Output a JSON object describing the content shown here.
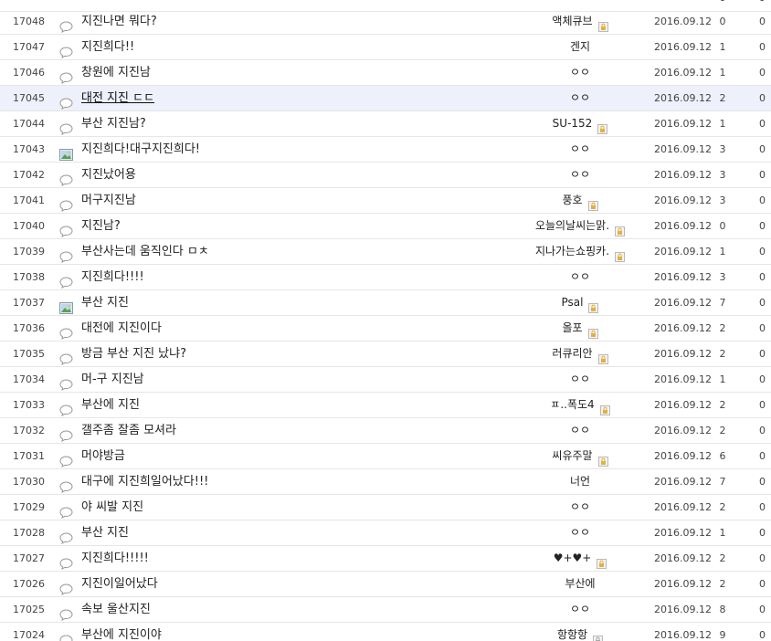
{
  "top_row": {
    "views": "0",
    "likes": "0"
  },
  "rows": [
    {
      "num": "17048",
      "icon": "speech-bubble-icon",
      "subject": "지진나면 뭐다?",
      "writer": "액체큐브",
      "badge": "gold-lock",
      "date": "2016.09.12",
      "views": "0",
      "likes": "0",
      "highlight": false
    },
    {
      "num": "17047",
      "icon": "speech-bubble-icon",
      "subject": "지진희다!!",
      "writer": "겐지",
      "badge": "",
      "date": "2016.09.12",
      "views": "1",
      "likes": "0",
      "highlight": false
    },
    {
      "num": "17046",
      "icon": "speech-bubble-icon",
      "subject": "창원에 지진남",
      "writer": "ㅇㅇ",
      "badge": "",
      "date": "2016.09.12",
      "views": "1",
      "likes": "0",
      "highlight": false
    },
    {
      "num": "17045",
      "icon": "speech-bubble-icon",
      "subject": "대전 지진 ㄷㄷ",
      "writer": "ㅇㅇ",
      "badge": "",
      "date": "2016.09.12",
      "views": "2",
      "likes": "0",
      "highlight": true
    },
    {
      "num": "17044",
      "icon": "speech-bubble-icon",
      "subject": "부산 지진남?",
      "writer": "SU-152",
      "badge": "gold-lock",
      "date": "2016.09.12",
      "views": "1",
      "likes": "0",
      "highlight": false
    },
    {
      "num": "17043",
      "icon": "image-icon",
      "subject": "지진희다!대구지진희다!",
      "writer": "ㅇㅇ",
      "badge": "",
      "date": "2016.09.12",
      "views": "3",
      "likes": "0",
      "highlight": false
    },
    {
      "num": "17042",
      "icon": "speech-bubble-icon",
      "subject": "지진났어용",
      "writer": "ㅇㅇ",
      "badge": "",
      "date": "2016.09.12",
      "views": "3",
      "likes": "0",
      "highlight": false
    },
    {
      "num": "17041",
      "icon": "speech-bubble-icon",
      "subject": "머구지진남",
      "writer": "풍호",
      "badge": "gold-lock",
      "date": "2016.09.12",
      "views": "3",
      "likes": "0",
      "highlight": false
    },
    {
      "num": "17040",
      "icon": "speech-bubble-icon",
      "subject": "지진남?",
      "writer": "오늘의날씨는맑.",
      "badge": "gold-lock",
      "date": "2016.09.12",
      "views": "0",
      "likes": "0",
      "highlight": false
    },
    {
      "num": "17039",
      "icon": "speech-bubble-icon",
      "subject": "부산사는데 움직인다 ㅁㅊ",
      "writer": "지나가는쇼핑카.",
      "badge": "gold-lock",
      "date": "2016.09.12",
      "views": "1",
      "likes": "0",
      "highlight": false
    },
    {
      "num": "17038",
      "icon": "speech-bubble-icon",
      "subject": "지진희다!!!!",
      "writer": "ㅇㅇ",
      "badge": "",
      "date": "2016.09.12",
      "views": "3",
      "likes": "0",
      "highlight": false
    },
    {
      "num": "17037",
      "icon": "image-icon",
      "subject": "부산 지진",
      "writer": "Psal",
      "badge": "gold-lock",
      "date": "2016.09.12",
      "views": "7",
      "likes": "0",
      "highlight": false
    },
    {
      "num": "17036",
      "icon": "speech-bubble-icon",
      "subject": "대전에 지진이다",
      "writer": "올포",
      "badge": "gold-lock",
      "date": "2016.09.12",
      "views": "2",
      "likes": "0",
      "highlight": false
    },
    {
      "num": "17035",
      "icon": "speech-bubble-icon",
      "subject": "방금 부산 지진 났냐?",
      "writer": "러큐리안",
      "badge": "gold-lock",
      "date": "2016.09.12",
      "views": "2",
      "likes": "0",
      "highlight": false
    },
    {
      "num": "17034",
      "icon": "speech-bubble-icon",
      "subject": "머-구 지진남",
      "writer": "ㅇㅇ",
      "badge": "",
      "date": "2016.09.12",
      "views": "1",
      "likes": "0",
      "highlight": false
    },
    {
      "num": "17033",
      "icon": "speech-bubble-icon",
      "subject": "부산에 지진",
      "writer": "ㅍ..폭도4",
      "badge": "gold-lock",
      "date": "2016.09.12",
      "views": "2",
      "likes": "0",
      "highlight": false
    },
    {
      "num": "17032",
      "icon": "speech-bubble-icon",
      "subject": "갤주좀 잘좀 모셔라",
      "writer": "ㅇㅇ",
      "badge": "",
      "date": "2016.09.12",
      "views": "2",
      "likes": "0",
      "highlight": false
    },
    {
      "num": "17031",
      "icon": "speech-bubble-icon",
      "subject": "머야방금",
      "writer": "씨유주말",
      "badge": "gold-lock",
      "date": "2016.09.12",
      "views": "6",
      "likes": "0",
      "highlight": false
    },
    {
      "num": "17030",
      "icon": "speech-bubble-icon",
      "subject": "대구에 지진희일어났다!!!",
      "writer": "너언",
      "badge": "",
      "date": "2016.09.12",
      "views": "7",
      "likes": "0",
      "highlight": false
    },
    {
      "num": "17029",
      "icon": "speech-bubble-icon",
      "subject": "야 씨발 지진",
      "writer": "ㅇㅇ",
      "badge": "",
      "date": "2016.09.12",
      "views": "2",
      "likes": "0",
      "highlight": false
    },
    {
      "num": "17028",
      "icon": "speech-bubble-icon",
      "subject": "부산 지진",
      "writer": "ㅇㅇ",
      "badge": "",
      "date": "2016.09.12",
      "views": "1",
      "likes": "0",
      "highlight": false
    },
    {
      "num": "17027",
      "icon": "speech-bubble-icon",
      "subject": "지진희다!!!!!",
      "writer": "♥+♥+",
      "badge": "gold-lock",
      "date": "2016.09.12",
      "views": "2",
      "likes": "0",
      "highlight": false
    },
    {
      "num": "17026",
      "icon": "speech-bubble-icon",
      "subject": "지진이일어났다",
      "writer": "부산에",
      "badge": "",
      "date": "2016.09.12",
      "views": "2",
      "likes": "0",
      "highlight": false
    },
    {
      "num": "17025",
      "icon": "speech-bubble-icon",
      "subject": "속보 울산지진",
      "writer": "ㅇㅇ",
      "badge": "",
      "date": "2016.09.12",
      "views": "8",
      "likes": "0",
      "highlight": false
    },
    {
      "num": "17024",
      "icon": "speech-bubble-icon",
      "subject": "부산에 지진이야",
      "writer": "항항항",
      "badge": "gray-lock",
      "date": "2016.09.12",
      "views": "9",
      "likes": "0",
      "highlight": false
    }
  ],
  "colors": {
    "row_border": "#e6e6e6",
    "highlight_bg": "#eef0fb",
    "lock_gold": "#e3b23c",
    "lock_gray": "#a8a8a8"
  }
}
